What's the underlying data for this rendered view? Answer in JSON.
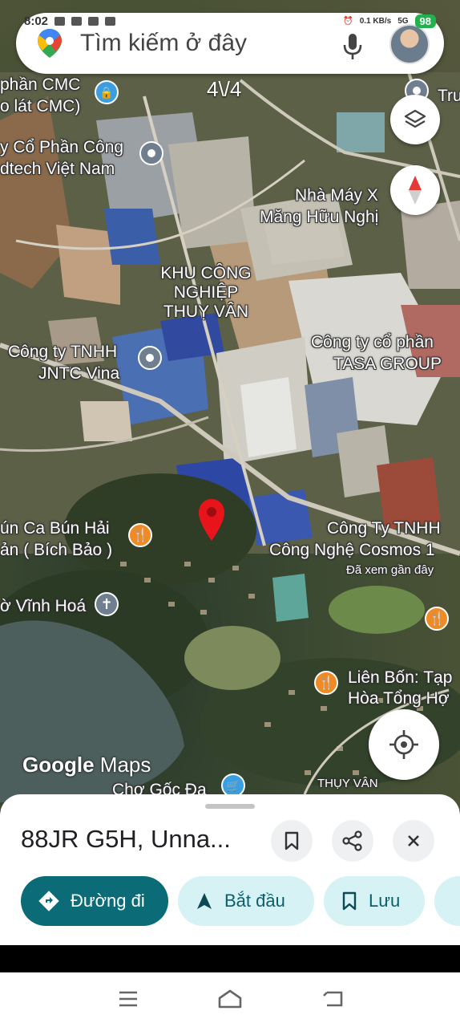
{
  "status_bar": {
    "time": "8:02",
    "network_speed": "0.1 KB/s",
    "network": "5G",
    "battery": "98"
  },
  "search": {
    "placeholder": "Tìm kiếm ở đây"
  },
  "map": {
    "photo_counter": "4\\/4",
    "attribution": {
      "google": "Google",
      "maps": "Maps"
    },
    "labels": [
      {
        "text": "phần CMC"
      },
      {
        "text": "o lát CMC)"
      },
      {
        "text": "Tru"
      },
      {
        "text": "y Cổ Phần Công"
      },
      {
        "text": "dtech Việt Nam"
      },
      {
        "text": "Nhà Máy X"
      },
      {
        "text": "Măng Hữu Nghị"
      },
      {
        "text": "KHU CÔNG"
      },
      {
        "text": "NGHIỆP"
      },
      {
        "text": "THUỴ VÂN"
      },
      {
        "text": "Công ty cổ phần"
      },
      {
        "text": "TASA GROUP"
      },
      {
        "text": "Công ty TNHH"
      },
      {
        "text": "JNTC Vina"
      },
      {
        "text": "ún Ca Bún Hải"
      },
      {
        "text": "ản ( Bích Bảo )"
      },
      {
        "text": "Công Ty TNHH"
      },
      {
        "text": "Công Nghệ Cosmos 1"
      },
      {
        "text": "Đã xem gần đây"
      },
      {
        "text": "ờ Vĩnh Hoá"
      },
      {
        "text": "Liên Bốn: Tạp"
      },
      {
        "text": "Hòa Tổng Hợ"
      },
      {
        "text": "Chợ Gốc Đa"
      },
      {
        "text": "THỤY VÂN"
      }
    ]
  },
  "place": {
    "title": "88JR G5H, Unna..."
  },
  "actions": {
    "directions": "Đường đi",
    "start": "Bắt đầu",
    "save": "Lưu"
  },
  "colors": {
    "primary": "#0b6c78",
    "chip": "#d6f2f4",
    "pin": "#e8141b"
  }
}
